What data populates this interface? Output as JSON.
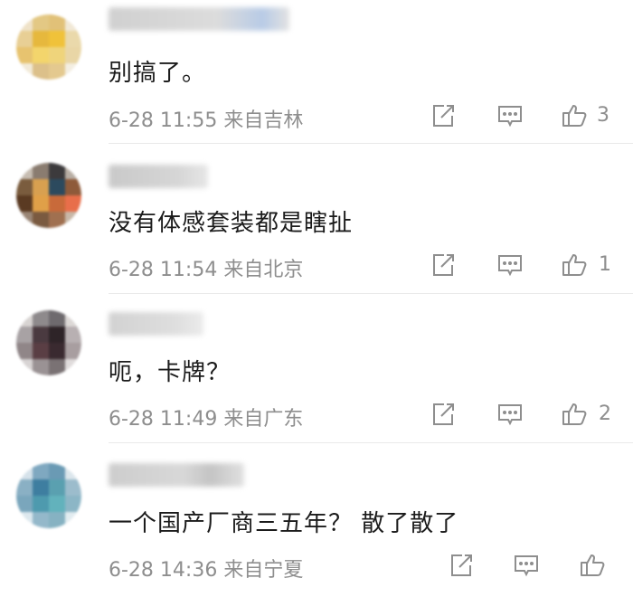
{
  "comments": [
    {
      "text": "别搞了。",
      "time": "6-28 11:55",
      "location": "来自吉林",
      "likes": "3"
    },
    {
      "text": "没有体感套装都是瞎扯",
      "time": "6-28 11:54",
      "location": "来自北京",
      "likes": "1"
    },
    {
      "text": "呃，卡牌？",
      "time": "6-28 11:49",
      "location": "来自广东",
      "likes": "2"
    },
    {
      "text": "一个国产厂商三五年？ 散了散了",
      "time": "6-28 14:36",
      "location": "来自宁夏",
      "likes": ""
    }
  ],
  "icons": {
    "share": "share-icon",
    "comment": "comment-icon",
    "like": "thumbs-up-icon"
  },
  "colors": {
    "meta_text": "#8e8e8e",
    "divider": "#e9e9e9"
  }
}
